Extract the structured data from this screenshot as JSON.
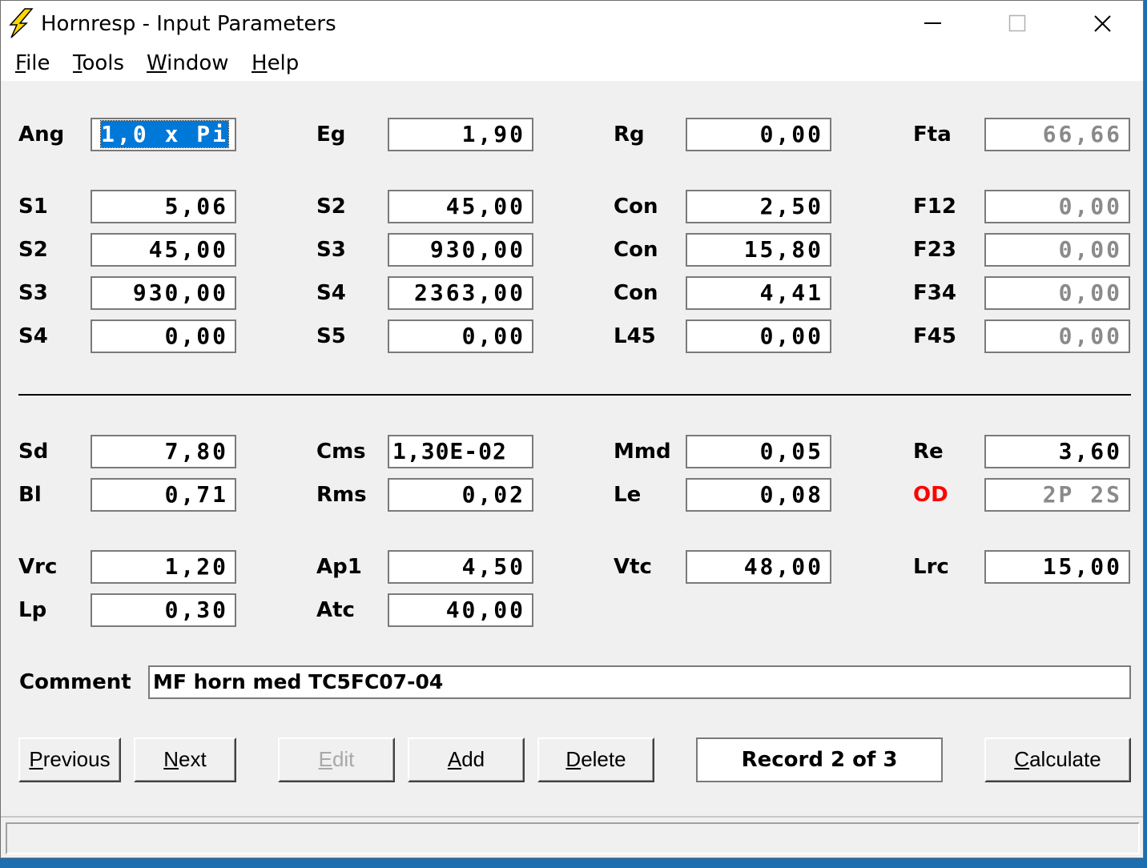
{
  "window": {
    "title": "Hornresp - Input Parameters",
    "accent_color": "#ffd700"
  },
  "menu": [
    "File",
    "Tools",
    "Window",
    "Help"
  ],
  "fields": [
    {
      "label": "Ang",
      "value": "1,0 x Pi",
      "selected": true
    },
    {
      "label": "Eg",
      "value": "1,90"
    },
    {
      "label": "Rg",
      "value": "0,00"
    },
    {
      "label": "Fta",
      "value": "66,66",
      "readonly": true
    },
    {
      "label": "S1",
      "value": "5,06"
    },
    {
      "label": "S2",
      "value": "45,00"
    },
    {
      "label": "Con",
      "value": "2,50"
    },
    {
      "label": "F12",
      "value": "0,00",
      "readonly": true
    },
    {
      "label": "S2",
      "value": "45,00"
    },
    {
      "label": "S3",
      "value": "930,00"
    },
    {
      "label": "Con",
      "value": "15,80"
    },
    {
      "label": "F23",
      "value": "0,00",
      "readonly": true
    },
    {
      "label": "S3",
      "value": "930,00"
    },
    {
      "label": "S4",
      "value": "2363,00"
    },
    {
      "label": "Con",
      "value": "4,41"
    },
    {
      "label": "F34",
      "value": "0,00",
      "readonly": true
    },
    {
      "label": "S4",
      "value": "0,00"
    },
    {
      "label": "S5",
      "value": "0,00"
    },
    {
      "label": "L45",
      "value": "0,00"
    },
    {
      "label": "F45",
      "value": "0,00",
      "readonly": true
    },
    {
      "label": "Sd",
      "value": "7,80"
    },
    {
      "label": "Cms",
      "value": "1,30E-02",
      "align": "left"
    },
    {
      "label": "Mmd",
      "value": "0,05"
    },
    {
      "label": "Re",
      "value": "3,60"
    },
    {
      "label": "Bl",
      "value": "0,71"
    },
    {
      "label": "Rms",
      "value": "0,02"
    },
    {
      "label": "Le",
      "value": "0,08"
    },
    {
      "label": "OD",
      "value": "2P 2S",
      "readonly": true,
      "label_color": "#ff0000"
    },
    {
      "label": "Vrc",
      "value": "1,20"
    },
    {
      "label": "Ap1",
      "value": "4,50"
    },
    {
      "label": "Vtc",
      "value": "48,00"
    },
    {
      "label": "Lrc",
      "value": "15,00"
    },
    {
      "label": "Lp",
      "value": "0,30"
    },
    {
      "label": "Atc",
      "value": "40,00"
    }
  ],
  "comment": {
    "label": "Comment",
    "value": "MF horn med TC5FC07-04"
  },
  "buttons": {
    "previous": "Previous",
    "next": "Next",
    "edit": "Edit",
    "add": "Add",
    "delete": "Delete",
    "calculate": "Calculate"
  },
  "record": "Record 2 of 3",
  "status": ""
}
